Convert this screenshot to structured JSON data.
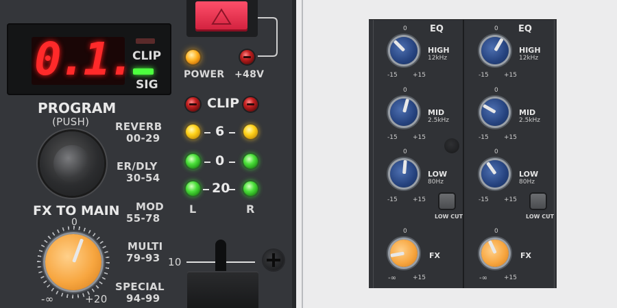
{
  "left_panel": {
    "display": {
      "value": "0.1."
    },
    "indicators": {
      "clip": "CLIP",
      "sig": "SIG"
    },
    "power": "POWER",
    "phantom": "+48V",
    "program": {
      "title": "PROGRAM",
      "sub": "(PUSH)"
    },
    "presets": [
      {
        "name": "REVERB",
        "range": "00-29"
      },
      {
        "name": "ER/DLY",
        "range": "30-54"
      },
      {
        "name": "MOD",
        "range": "55-78"
      },
      {
        "name": "MULTI",
        "range": "79-93"
      },
      {
        "name": "SPECIAL",
        "range": "94-99"
      }
    ],
    "meter": {
      "clip": "CLIP",
      "six": "6",
      "zero": "0",
      "twenty": "20",
      "left": "L",
      "right": "R"
    },
    "fx_to_main": {
      "title": "FX TO MAIN",
      "zero": "0",
      "min": "-∞",
      "max": "+20"
    },
    "fader": {
      "mark": "10"
    }
  },
  "right_panel": {
    "channels": [
      {
        "eq_label": "EQ",
        "high": {
          "label": "HIGH",
          "freq": "12kHz",
          "zero": "0",
          "min": "-15",
          "max": "+15"
        },
        "mid": {
          "label": "MID",
          "freq": "2.5kHz",
          "zero": "0",
          "min": "-15",
          "max": "+15"
        },
        "low": {
          "label": "LOW",
          "freq": "80Hz",
          "zero": "0",
          "min": "-15",
          "max": "+15"
        },
        "low_cut": "LOW CUT",
        "fx": {
          "label": "FX",
          "zero": "0",
          "min": "-∞",
          "max": "+15"
        }
      },
      {
        "eq_label": "EQ",
        "high": {
          "label": "HIGH",
          "freq": "12kHz",
          "zero": "0",
          "min": "-15",
          "max": "+15"
        },
        "mid": {
          "label": "MID",
          "freq": "2.5kHz",
          "zero": "0",
          "min": "-15",
          "max": "+15"
        },
        "low": {
          "label": "LOW",
          "freq": "80Hz",
          "zero": "0",
          "min": "-15",
          "max": "+15"
        },
        "low_cut": "LOW CUT",
        "fx": {
          "label": "FX",
          "zero": "0",
          "min": "-∞",
          "max": "+15"
        }
      }
    ]
  },
  "colors": {
    "panel": "#34363a",
    "display_red": "#ff2a2a",
    "knob_blue": "#25427e",
    "knob_orange": "#f7a640",
    "led_green": "#4be03a",
    "led_yellow": "#ffd21a"
  }
}
